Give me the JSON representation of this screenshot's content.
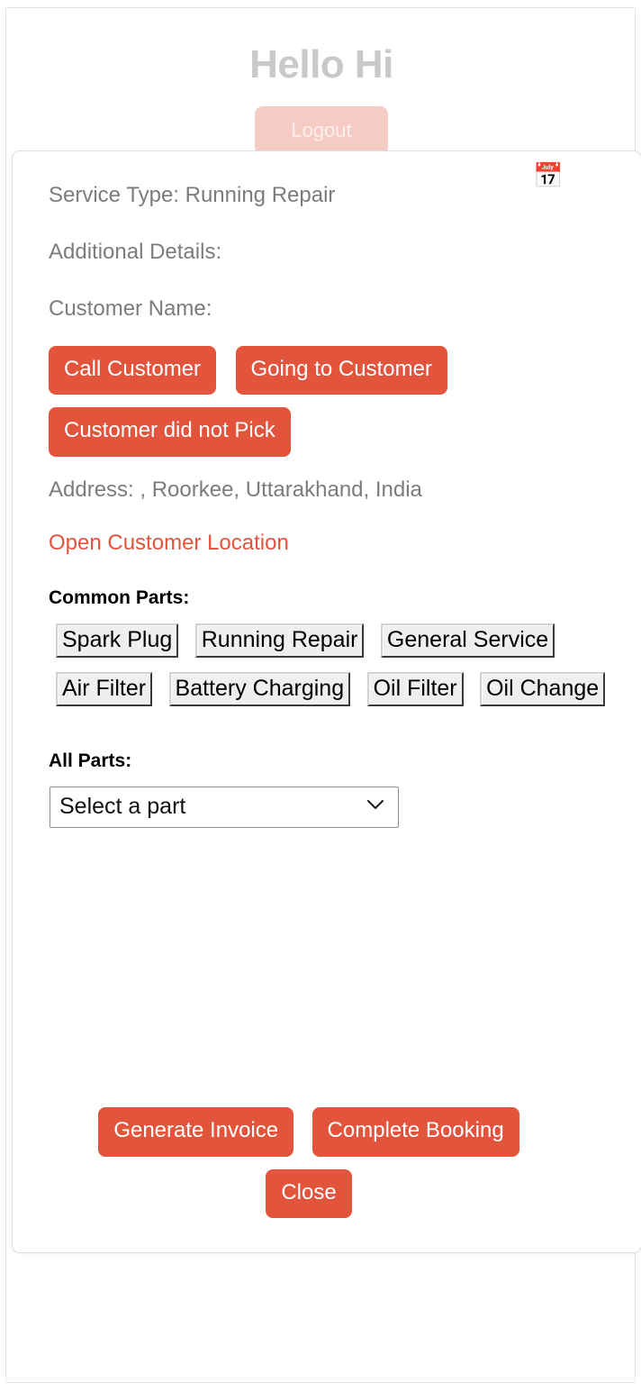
{
  "page": {
    "greeting": "Hello Hi",
    "logout_label": "Logout"
  },
  "modal": {
    "service_type_line": "Service Type: Running Repair",
    "additional_details_line": "Additional Details:",
    "customer_name_line": "Customer Name:",
    "calendar_icon": "📅",
    "contact_actions": [
      {
        "label": "Call Customer"
      },
      {
        "label": "Going to Customer"
      },
      {
        "label": "Customer did not Pick"
      }
    ],
    "address_line": "Address: , Roorkee, Uttarakhand, India",
    "open_location_link": "Open Customer Location",
    "common_parts_label": "Common Parts:",
    "common_parts": [
      {
        "label": "Spark Plug"
      },
      {
        "label": "Running Repair"
      },
      {
        "label": "General Service"
      },
      {
        "label": "Air Filter"
      },
      {
        "label": "Battery Charging"
      },
      {
        "label": "Oil Filter"
      },
      {
        "label": "Oil Change"
      }
    ],
    "all_parts_label": "All Parts:",
    "part_select": {
      "selected": "Select a part",
      "options": [
        "Select a part"
      ],
      "chevron_icon": "chevron-down-icon"
    },
    "footer": {
      "generate_invoice_label": "Generate Invoice",
      "complete_booking_label": "Complete Booking",
      "close_label": "Close"
    }
  },
  "colors": {
    "accent": "#e2543c",
    "accent_faded": "#f6cbc4",
    "muted_text": "#7c7c7c",
    "heading_faded": "#c9c9c9"
  }
}
